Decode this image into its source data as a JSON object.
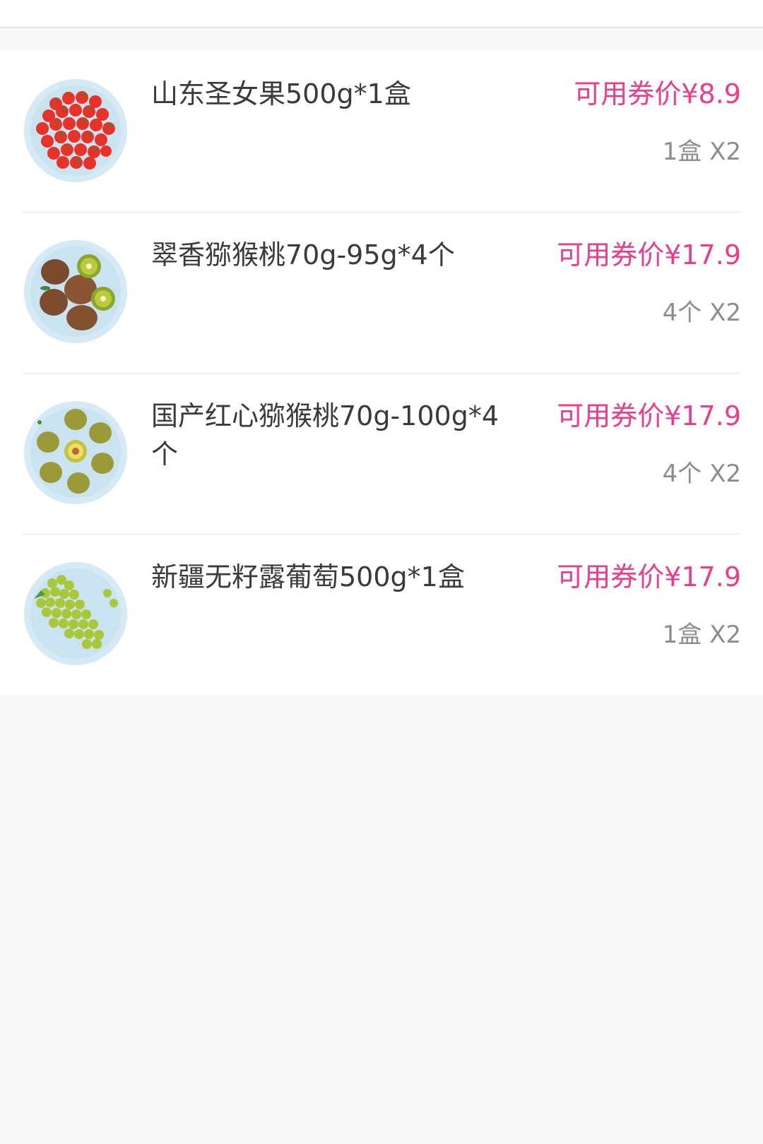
{
  "colors": {
    "accent_price": "#ea3d8a",
    "text_primary": "#3a3a3a",
    "text_secondary": "#8d8d8d",
    "page_background": "#f8f8f8"
  },
  "products": [
    {
      "image": "cherry-tomatoes-plate-image",
      "name": "山东圣女果500g*1盒",
      "price": "可用券价¥8.9",
      "quantity": "1盒 X2"
    },
    {
      "image": "kiwifruit-plate-image",
      "name": "翠香猕猴桃70g-95g*4个",
      "price": "可用券价¥17.9",
      "quantity": "4个 X2"
    },
    {
      "image": "red-heart-kiwifruit-plate-image",
      "name": "国产红心猕猴桃70g-100g*4个",
      "price": "可用券价¥17.9",
      "quantity": "4个 X2"
    },
    {
      "image": "seedless-grapes-plate-image",
      "name": "新疆无籽露葡萄500g*1盒",
      "price": "可用券价¥17.9",
      "quantity": "1盒 X2"
    }
  ]
}
